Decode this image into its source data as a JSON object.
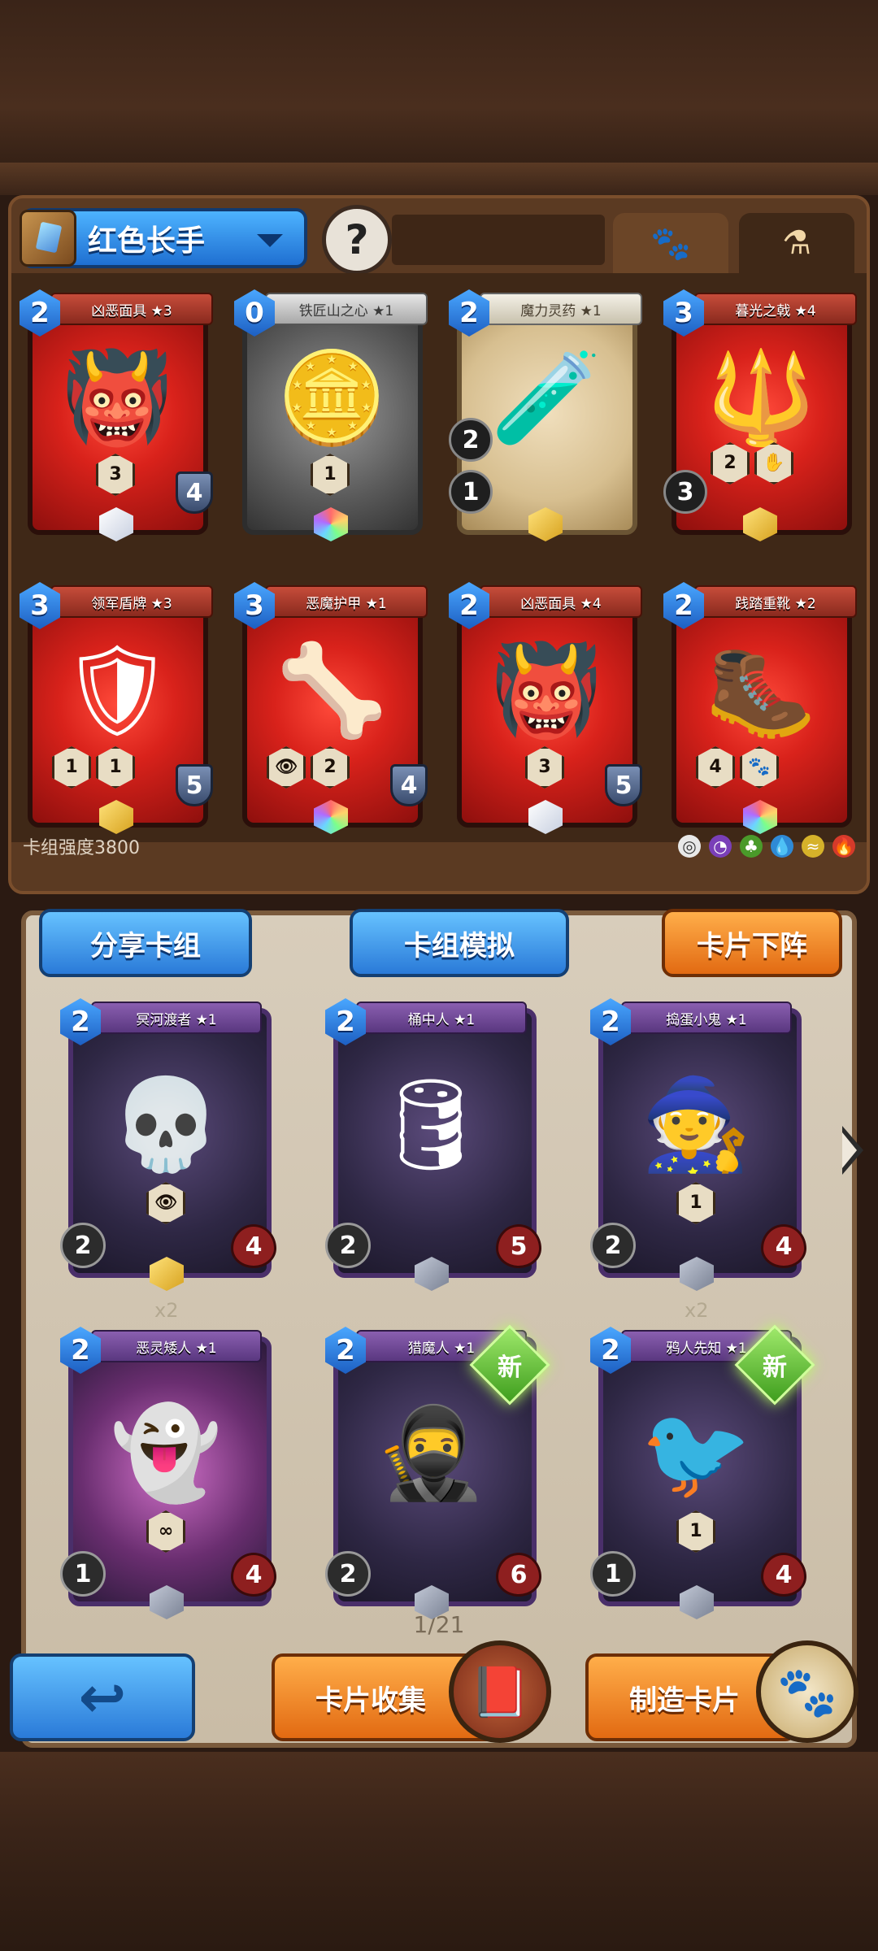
{
  "deck": {
    "name": "红色长手",
    "hero_placeholder": "?",
    "strength_label": "卡组强度3800"
  },
  "tabs": {
    "paw_icon": "paw-icon",
    "potion_icon": "potion-icon"
  },
  "deck_cards": [
    {
      "name": "凶恶面具 ★3",
      "cost": "2",
      "style": "red",
      "art": "👹",
      "badge1": "3",
      "shield": "4",
      "gem": "white"
    },
    {
      "name": "铁匠山之心 ★1",
      "cost": "0",
      "style": "gray",
      "art": "🪙",
      "badge1": "1",
      "shield": "",
      "gem": "rainbow"
    },
    {
      "name": "魔力灵药 ★1",
      "cost": "2",
      "style": "tan",
      "art": "🧪",
      "side1": "2",
      "side2": "1",
      "gem": "gold"
    },
    {
      "name": "暮光之戟 ★4",
      "cost": "3",
      "style": "red",
      "art": "🔱",
      "badge1": "2",
      "side1": "3",
      "gem": "gold"
    },
    {
      "name": "领军盾牌 ★3",
      "cost": "3",
      "style": "red",
      "art": "🛡",
      "badge1": "1",
      "badge2": "1",
      "shield": "5",
      "gem": "gold"
    },
    {
      "name": "恶魔护甲 ★1",
      "cost": "3",
      "style": "red",
      "art": "🦴",
      "badge1": "",
      "badge2": "2",
      "shield": "4",
      "gem": "rainbow"
    },
    {
      "name": "凶恶面具 ★4",
      "cost": "2",
      "style": "red",
      "art": "👹",
      "badge1": "3",
      "shield": "5",
      "gem": "white"
    },
    {
      "name": "践踏重靴 ★2",
      "cost": "2",
      "style": "red",
      "art": "🥾",
      "badge1": "4",
      "badge2": "",
      "gem": "rainbow"
    }
  ],
  "actions": {
    "share": "分享卡组",
    "simulate": "卡组模拟",
    "remove": "卡片下阵"
  },
  "collection_cards": [
    {
      "name": "冥河渡者 ★1",
      "cost": "2",
      "art": "💀",
      "atk": "2",
      "hp": "4",
      "badge": "",
      "gem": "gold",
      "count": "",
      "is_new": false
    },
    {
      "name": "桶中人 ★1",
      "cost": "2",
      "art": "🛢",
      "atk": "2",
      "hp": "5",
      "badge": "",
      "gem": "gray",
      "count": "",
      "is_new": false
    },
    {
      "name": "捣蛋小鬼 ★1",
      "cost": "2",
      "art": "🧙",
      "atk": "2",
      "hp": "4",
      "badge": "1",
      "gem": "gray",
      "count": "",
      "is_new": false
    },
    {
      "name": "恶灵矮人 ★1",
      "cost": "2",
      "art": "👻",
      "atk": "1",
      "hp": "4",
      "badge": "",
      "gem": "gray",
      "count": "x2",
      "is_new": false
    },
    {
      "name": "猎魔人 ★1",
      "cost": "2",
      "art": "🥷",
      "atk": "2",
      "hp": "6",
      "badge": "",
      "gem": "gray",
      "count": "",
      "is_new": true
    },
    {
      "name": "鸦人先知 ★1",
      "cost": "2",
      "art": "🐦",
      "atk": "1",
      "hp": "4",
      "badge": "1",
      "gem": "gray",
      "count": "x2",
      "is_new": true
    }
  ],
  "new_label": "新",
  "pagination": "1/21",
  "bottom": {
    "collection": "卡片收集",
    "craft": "制造卡片"
  },
  "colors": {
    "accent_blue": "#2a7ad8",
    "accent_orange": "#e26a12"
  }
}
